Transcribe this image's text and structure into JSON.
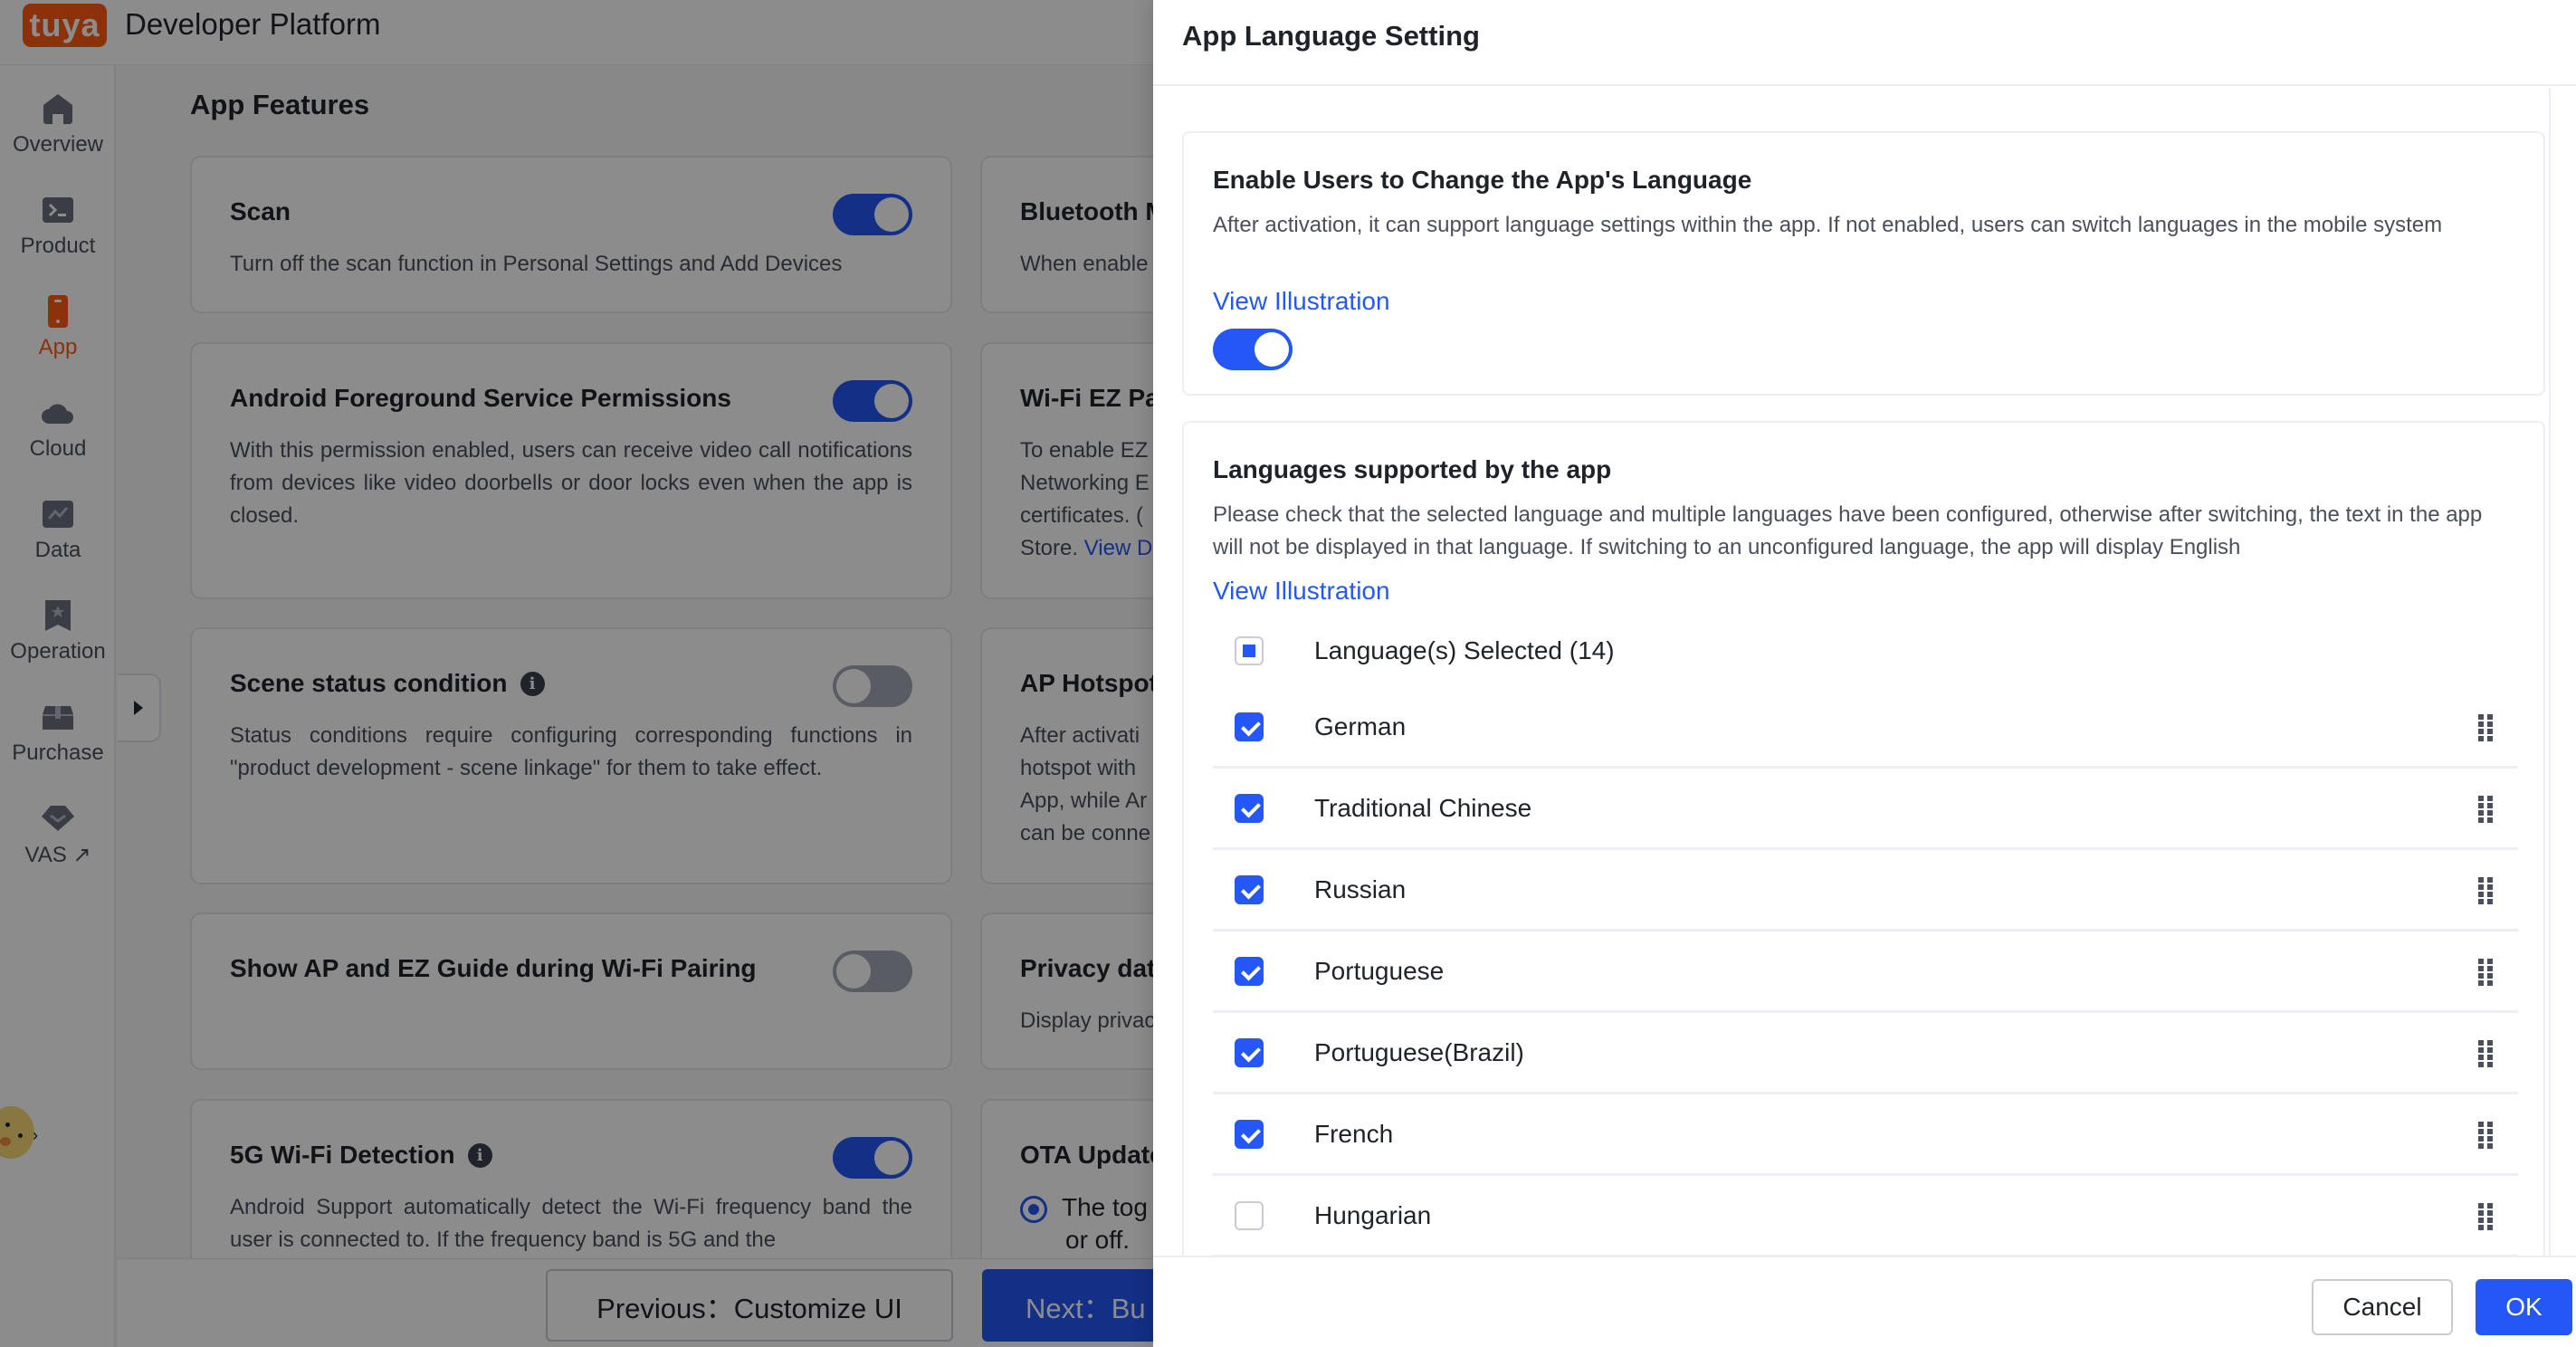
{
  "topbar": {
    "logo_text": "tuya",
    "platform_name": "Developer Platform"
  },
  "sidebar": {
    "items": [
      {
        "label": "Overview",
        "icon": "home-icon",
        "active": false
      },
      {
        "label": "Product",
        "icon": "terminal-icon",
        "active": false
      },
      {
        "label": "App",
        "icon": "phone-icon",
        "active": true
      },
      {
        "label": "Cloud",
        "icon": "cloud-icon",
        "active": false
      },
      {
        "label": "Data",
        "icon": "chart-icon",
        "active": false
      },
      {
        "label": "Operation",
        "icon": "bookmark-star-icon",
        "active": false
      },
      {
        "label": "Purchase",
        "icon": "box-icon",
        "active": false
      },
      {
        "label": "VAS",
        "icon": "diamond-icon",
        "active": false,
        "external": "↗"
      }
    ],
    "accent_color": "#ff5b14"
  },
  "main": {
    "title": "App Features",
    "cards": [
      {
        "title": "Scan",
        "description": "Turn off the scan function in Personal Settings and Add Devices",
        "switch_on": true
      },
      {
        "title": "Bluetooth M",
        "description": "When enable"
      },
      {
        "title": "Android Foreground Service Permissions",
        "description": "With this permission enabled, users can receive video call notifications from devices like video doorbells or door locks even when the app is closed.",
        "switch_on": true
      },
      {
        "title": "Wi-Fi EZ Pa",
        "description_lines": [
          "To enable EZ",
          "Networking E",
          "certificates. (",
          "Store."
        ],
        "link": "View D"
      },
      {
        "title": "Scene status condition",
        "has_info": true,
        "description": "Status conditions require configuring corresponding functions in \"product development - scene linkage\" for them to take effect.",
        "switch_on": false
      },
      {
        "title": "AP Hotspot",
        "description_lines": [
          "After activati",
          "hotspot with",
          "App, while Ar",
          "can be conne"
        ]
      },
      {
        "title": "Show AP and EZ Guide during Wi-Fi Pairing",
        "switch_on": false
      },
      {
        "title": "Privacy dat",
        "description": "Display privac"
      },
      {
        "title": "5G Wi-Fi Detection",
        "has_info": true,
        "description": "Android Support automatically detect the Wi-Fi frequency band the user is connected to. If the frequency band is 5G and the",
        "switch_on": true
      },
      {
        "title": "OTA Update",
        "radio_label": "The tog",
        "radio_label_2": "or off."
      }
    ],
    "prev_button": "Previous：Customize UI",
    "next_button": "Next：Bu"
  },
  "drawer": {
    "title": "App Language Setting",
    "section1": {
      "title": "Enable Users to Change the App's Language",
      "description": "After activation, it can support language settings within the app. If not enabled, users can switch languages in the mobile system",
      "link": "View Illustration",
      "switch_on": true
    },
    "section2": {
      "title": "Languages supported by the app",
      "description": "Please check that the selected language and multiple languages have been configured, otherwise after switching, the text in the app will not be displayed in that language. If switching to an unconfigured language, the app will display English",
      "link": "View Illustration",
      "select_all_label": "Language(s) Selected (14)",
      "select_all_state": "indeterminate",
      "languages": [
        {
          "name": "German",
          "checked": true
        },
        {
          "name": "Traditional Chinese",
          "checked": true
        },
        {
          "name": "Russian",
          "checked": true
        },
        {
          "name": "Portuguese",
          "checked": true
        },
        {
          "name": "Portuguese(Brazil)",
          "checked": true
        },
        {
          "name": "French",
          "checked": true
        },
        {
          "name": "Hungarian",
          "checked": false
        }
      ]
    },
    "cancel_label": "Cancel",
    "ok_label": "OK",
    "primary_color": "#2457f5"
  }
}
